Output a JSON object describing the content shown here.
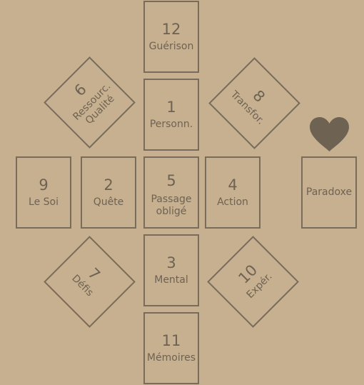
{
  "cards": {
    "c12": {
      "num": "12",
      "label": "Guérison"
    },
    "c1": {
      "num": "1",
      "label": "Personn."
    },
    "c9": {
      "num": "9",
      "label": "Le Soi"
    },
    "c2": {
      "num": "2",
      "label": "Quête"
    },
    "c5": {
      "num": "5",
      "label_line1": "Passage",
      "label_line2": "obligé"
    },
    "c4": {
      "num": "4",
      "label": "Action"
    },
    "c3": {
      "num": "3",
      "label": "Mental"
    },
    "c11": {
      "num": "11",
      "label": "Mémoires"
    },
    "paradoxe": {
      "label": "Paradoxe"
    }
  },
  "diamonds": {
    "d6": {
      "num": "6",
      "label_line1": "Ressourc.",
      "label_line2": "Qualité"
    },
    "d8": {
      "num": "8",
      "label": "Transfor."
    },
    "d7": {
      "num": "7",
      "label": "Défis"
    },
    "d10": {
      "num": "10",
      "label": "Expér."
    }
  },
  "icons": {
    "heart": "heart-icon",
    "heart_color": "#6e6253"
  }
}
